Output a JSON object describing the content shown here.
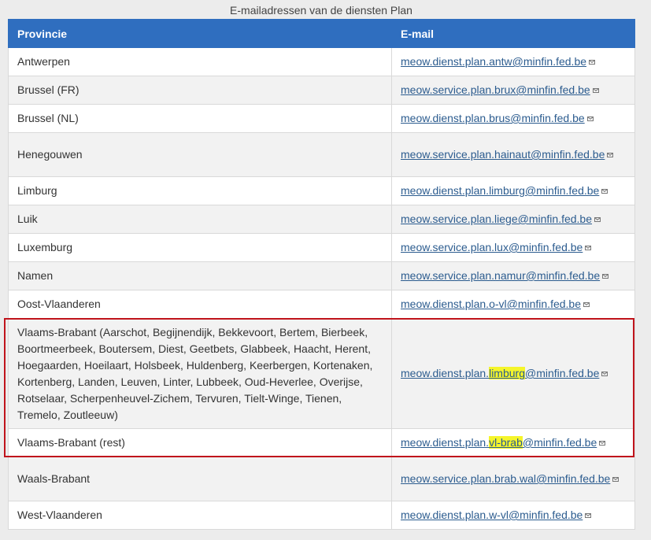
{
  "caption": "E-mailadressen van de diensten Plan",
  "headers": {
    "province": "Provincie",
    "email": "E-mail"
  },
  "colors": {
    "header_bg": "#2f6ebf",
    "link": "#2c5c8f",
    "highlight": "#f5f52a",
    "annotation_box": "#c0141c"
  },
  "icon": "mail-icon",
  "rows": [
    {
      "province": "Antwerpen",
      "email": "meow.dienst.plan.antw@minfin.fed.be"
    },
    {
      "province": "Brussel (FR)",
      "email": "meow.service.plan.brux@minfin.fed.be"
    },
    {
      "province": "Brussel (NL)",
      "email": "meow.dienst.plan.brus@minfin.fed.be"
    },
    {
      "province": "Henegouwen",
      "email": "meow.service.plan.hainaut@minfin.fed.be"
    },
    {
      "province": "Limburg",
      "email": "meow.dienst.plan.limburg@minfin.fed.be"
    },
    {
      "province": "Luik",
      "email": "meow.service.plan.liege@minfin.fed.be"
    },
    {
      "province": "Luxemburg",
      "email": "meow.service.plan.lux@minfin.fed.be"
    },
    {
      "province": "Namen",
      "email": "meow.service.plan.namur@minfin.fed.be"
    },
    {
      "province": "Oost-Vlaanderen",
      "email": "meow.dienst.plan.o-vl@minfin.fed.be"
    },
    {
      "province": "Vlaams-Brabant (Aarschot, Begijnendijk, Bekkevoort, Bertem, Bierbeek, Boortmeerbeek, Boutersem, Diest, Geetbets, Glabbeek, Haacht, Herent, Hoegaarden, Hoeilaart, Holsbeek, Huldenberg, Keerbergen, Kortenaken, Kortenberg, Landen, Leuven, Linter, Lubbeek, Oud-Heverlee, Overijse, Rotselaar, Scherpenheuvel-Zichem, Tervuren, Tielt-Winge, Tienen, Tremelo, Zoutleeuw)",
      "email_pre": "meow.dienst.plan.",
      "email_hl": "limburg",
      "email_post": "@minfin.fed.be"
    },
    {
      "province": "Vlaams-Brabant (rest)",
      "email_pre": "meow.dienst.plan.",
      "email_hl": "vl-brab",
      "email_post": "@minfin.fed.be"
    },
    {
      "province": "Waals-Brabant",
      "email": "meow.service.plan.brab.wal@minfin.fed.be"
    },
    {
      "province": "West-Vlaanderen",
      "email": "meow.dienst.plan.w-vl@minfin.fed.be"
    }
  ]
}
